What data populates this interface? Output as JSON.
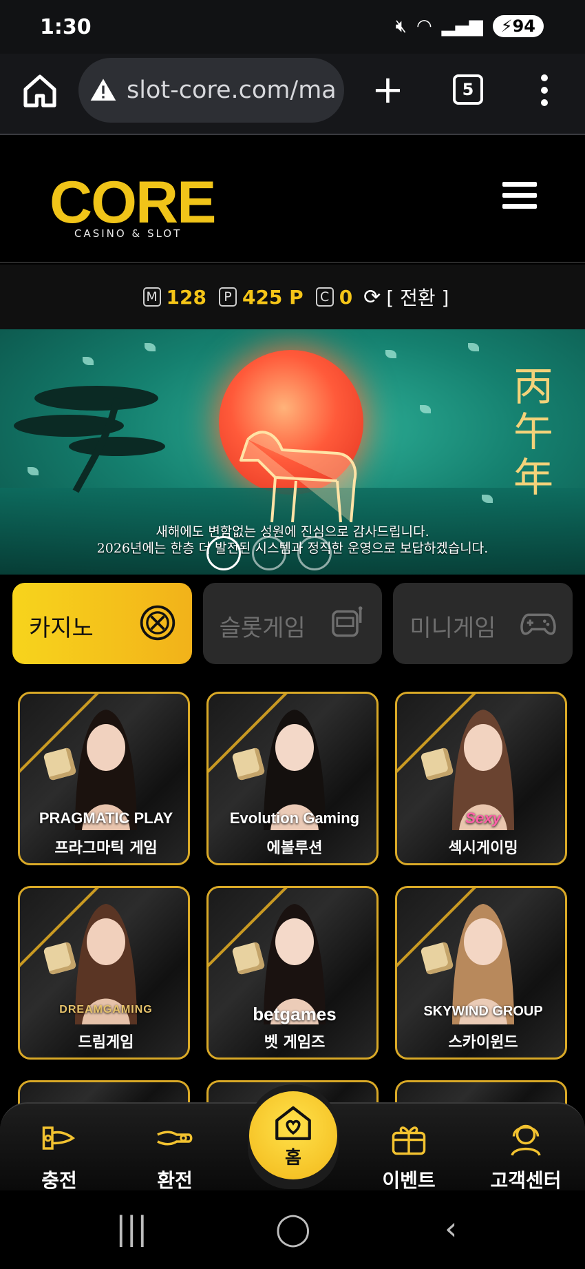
{
  "status_bar": {
    "time": "1:30",
    "battery": "94"
  },
  "browser": {
    "url": "slot-core.com/ma",
    "tab_count": "5"
  },
  "site": {
    "logo_text": "CORE",
    "logo_sub": "CASINO & SLOT"
  },
  "points": {
    "m_badge": "M",
    "m_value": "128",
    "p_badge": "P",
    "p_value": "425 P",
    "c_badge": "C",
    "c_value": "0",
    "switch_label": "[ 전환 ]"
  },
  "banner": {
    "title": "丙午年",
    "line1": "새해에도 변함없는 성원에 진심으로 감사드립니다.",
    "line2": "2026년에는 한층 더 발전된 시스템과 정직한 운영으로 보답하겠습니다."
  },
  "category_tabs": [
    {
      "label": "카지노",
      "icon": "roulette-icon",
      "active": true
    },
    {
      "label": "슬롯게임",
      "icon": "slot-machine-icon",
      "active": false
    },
    {
      "label": "미니게임",
      "icon": "gamepad-icon",
      "active": false
    }
  ],
  "games": [
    {
      "brand": "PRAGMATIC PLAY",
      "name": "프라그마틱 게임"
    },
    {
      "brand": "Evolution Gaming",
      "name": "에볼루션"
    },
    {
      "brand": "Sexy",
      "name": "섹시게이밍"
    },
    {
      "brand": "DREAMGAMING",
      "name": "드림게임"
    },
    {
      "brand": "betgames",
      "name": "벳 게임즈"
    },
    {
      "brand": "SKYWIND GROUP",
      "name": "스카이윈드"
    }
  ],
  "bottom_nav": {
    "charge": "충전",
    "exchange": "환전",
    "home": "홈",
    "event": "이벤트",
    "support": "고객센터"
  },
  "colors": {
    "accent": "#f5c518",
    "card_border": "#d9a927",
    "banner_bg": "#15806f"
  }
}
